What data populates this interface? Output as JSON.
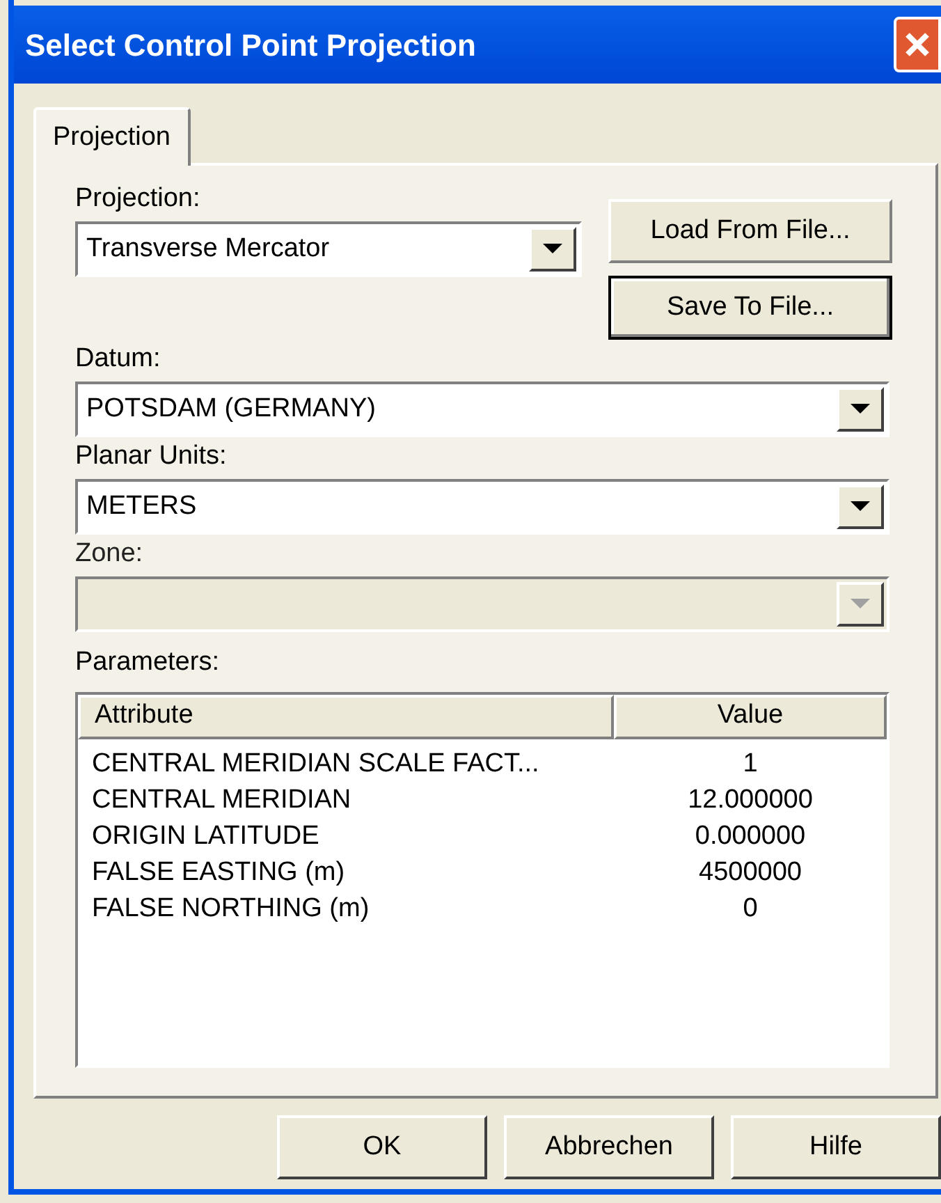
{
  "window": {
    "title": "Select Control Point Projection"
  },
  "tabs": [
    {
      "label": "Projection",
      "selected": true
    }
  ],
  "side_buttons": [
    {
      "label": "Load From File...",
      "default": false
    },
    {
      "label": "Save To File...",
      "default": true
    }
  ],
  "fields": [
    {
      "label": "Projection:",
      "value": "Transverse Mercator",
      "disabled": false
    },
    {
      "label": "Datum:",
      "value": "POTSDAM (GERMANY)",
      "disabled": false
    },
    {
      "label": "Planar Units:",
      "value": "METERS",
      "disabled": false
    },
    {
      "label": "Zone:",
      "disabled": true
    }
  ],
  "parameters": {
    "label": "Parameters:",
    "columns": [
      "Attribute",
      "Value"
    ],
    "rows": [
      [
        "CENTRAL MERIDIAN SCALE FACT...",
        "1"
      ],
      [
        "CENTRAL MERIDIAN",
        "12.000000"
      ],
      [
        "ORIGIN LATITUDE",
        "0.000000"
      ],
      [
        "FALSE EASTING (m)",
        "4500000"
      ],
      [
        "FALSE NORTHING (m)",
        "0"
      ]
    ]
  },
  "buttons": [
    "OK",
    "Abbrechen",
    "Hilfe"
  ]
}
